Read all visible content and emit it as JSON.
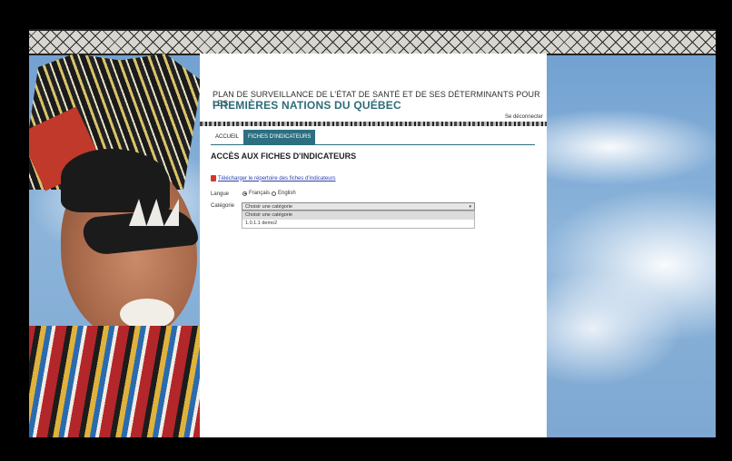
{
  "header": {
    "title_line_1": "PLAN DE SURVEILLANCE DE L'ÉTAT DE SANTÉ ET DE SES DÉTERMINANTS POUR LES",
    "title_line_2": "PREMIÈRES NATIONS DU QUÉBEC",
    "logout_label": "Se déconnecter"
  },
  "tabs": [
    {
      "label": "ACCUEIL",
      "active": false
    },
    {
      "label": "FICHES D'INDICATEURS",
      "active": true
    }
  ],
  "main": {
    "section_title": "ACCÈS AUX FICHES D'INDICATEURS",
    "download_link": "Télécharger le répertoire des fiches d'indicateurs",
    "language_label": "Langue",
    "language_options": [
      {
        "label": "Français",
        "checked": true
      },
      {
        "label": "English",
        "checked": false
      }
    ],
    "category_label": "Catégorie",
    "category_select_value": "Choisir une catégorie",
    "category_options": [
      "Choisir une catégorie",
      "1.0.1.1 demo2"
    ]
  },
  "colors": {
    "accent": "#2c6f80",
    "title_color": "#2d6c77",
    "link_color": "#2b3fb0"
  },
  "icons": {
    "download": "pdf-icon",
    "select_toggle": "chevron-down-icon"
  }
}
